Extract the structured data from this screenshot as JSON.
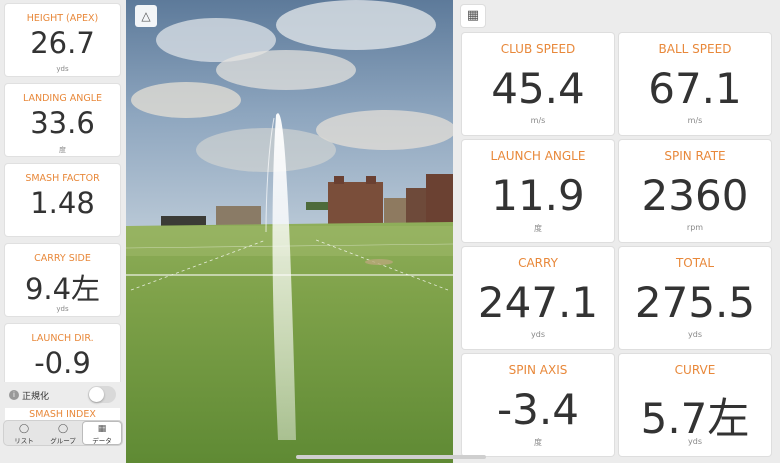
{
  "left_metrics": [
    {
      "label": "HEIGHT (APEX)",
      "value": "26.7",
      "unit": "yds"
    },
    {
      "label": "LANDING ANGLE",
      "value": "33.6",
      "unit": "度"
    },
    {
      "label": "SMASH FACTOR",
      "value": "1.48",
      "unit": ""
    },
    {
      "label": "CARRY SIDE",
      "value": "9.4左",
      "unit": "yds"
    },
    {
      "label": "LAUNCH DIR.",
      "value": "-0.9",
      "unit": ""
    }
  ],
  "peek_label": "SMASH INDEX",
  "normalize": {
    "label": "正規化",
    "icon": "info-icon",
    "enabled": false
  },
  "tabs": [
    {
      "label": "リスト",
      "icon": "tag-icon"
    },
    {
      "label": "グループ",
      "icon": "tags-icon"
    },
    {
      "label": "データ",
      "icon": "grid-icon",
      "active": true
    }
  ],
  "view_toggle_icon": "trajectory-view-icon",
  "grid_toggle_icon": "grid-view-icon",
  "right_metrics": [
    {
      "label": "CLUB SPEED",
      "value": "45.4",
      "unit": "m/s"
    },
    {
      "label": "BALL SPEED",
      "value": "67.1",
      "unit": "m/s"
    },
    {
      "label": "LAUNCH ANGLE",
      "value": "11.9",
      "unit": "度"
    },
    {
      "label": "SPIN RATE",
      "value": "2360",
      "unit": "rpm"
    },
    {
      "label": "CARRY",
      "value": "247.1",
      "unit": "yds"
    },
    {
      "label": "TOTAL",
      "value": "275.5",
      "unit": "yds"
    },
    {
      "label": "SPIN AXIS",
      "value": "-3.4",
      "unit": "度"
    },
    {
      "label": "CURVE",
      "value": "5.7左",
      "unit": "yds"
    }
  ],
  "colors": {
    "accent": "#e8883a",
    "value": "#333333",
    "card": "#ffffff",
    "panel": "#ececec"
  }
}
